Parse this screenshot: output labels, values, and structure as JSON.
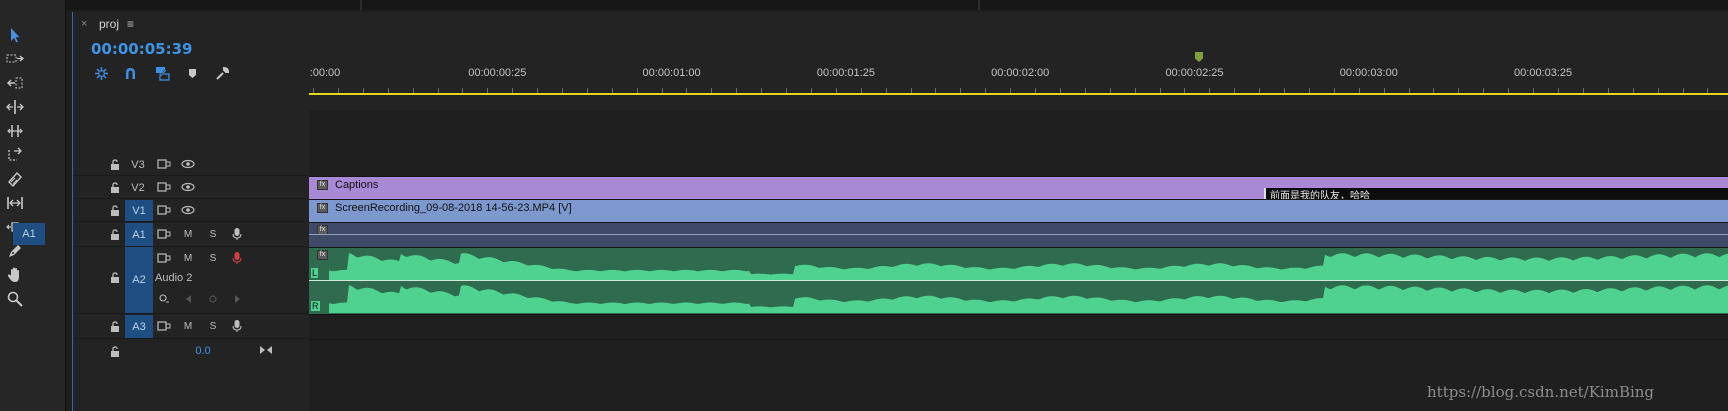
{
  "sequence": {
    "tab_title": "proj",
    "close_glyph": "×",
    "menu_glyph": "≡",
    "timecode": "00:00:05:39"
  },
  "tools_column": [
    {
      "name": "selection-tool-icon",
      "active": true
    },
    {
      "name": "track-select-tool-icon"
    },
    {
      "name": "ripple-edit-tool-icon"
    },
    {
      "name": "rolling-edit-tool-icon"
    },
    {
      "name": "rate-stretch-tool-icon"
    },
    {
      "name": "razor-tool-icon"
    },
    {
      "name": "slip-tool-icon"
    },
    {
      "name": "slide-tool-icon"
    },
    {
      "name": "pen-tool-icon"
    },
    {
      "name": "hand-tool-icon"
    },
    {
      "name": "zoom-tool-icon"
    }
  ],
  "panel_tools": [
    "nest-icon",
    "snap-magnet-icon",
    "linked-selection-icon",
    "add-marker-icon",
    "wrench-icon"
  ],
  "ruler": {
    "labels": [
      ":00:00",
      "00:00:00:25",
      "00:00:01:00",
      "00:00:01:25",
      "00:00:02:00",
      "00:00:02:25",
      "00:00:03:00",
      "00:00:03:25"
    ]
  },
  "track_headers": {
    "v3": "V3",
    "v2": "V2",
    "v1": "V1",
    "a1_source": "A1",
    "a1": "A1",
    "a2": "A2",
    "a2_name": "Audio 2",
    "a3": "A3",
    "mute": "M",
    "solo": "S",
    "master_volume": "0.0"
  },
  "clips": {
    "captions_label": "Captions",
    "caption_text": "前面是我的队友，哈哈",
    "video_label": "ScreenRecording_09-08-2018 14-56-23.MP4 [V]",
    "fx_badge": "fx",
    "channel_left": "L",
    "channel_right": "R"
  },
  "colors": {
    "accent": "#3f94e6",
    "captions_clip": "#a889d6",
    "video_clip": "#7d98cf",
    "audio_clip_bg": "#2e6b4f",
    "audio_wave": "#4fd28f",
    "ruler_line": "#e7d71b",
    "playhead": "#7fa03a",
    "record_active": "#d24141"
  },
  "watermark": "https://blog.csdn.net/KimBing"
}
